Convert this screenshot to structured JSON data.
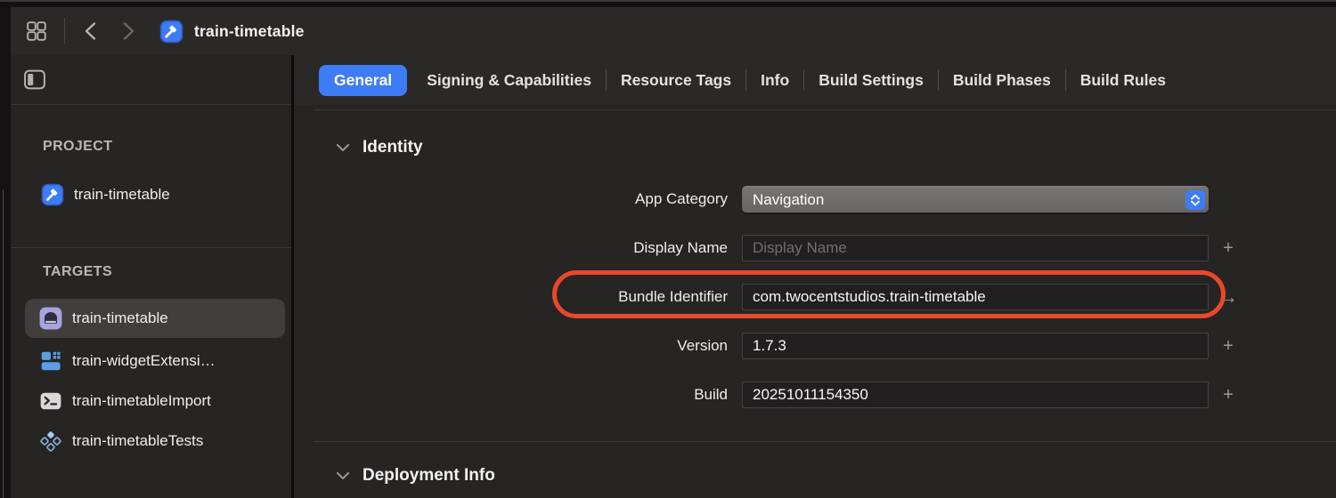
{
  "toolbar": {
    "title": "train-timetable",
    "icons": [
      "apps-grid-icon",
      "back-chevron-icon",
      "forward-chevron-icon",
      "xcode-project-icon"
    ]
  },
  "tabs": [
    {
      "label": "General",
      "selected": true
    },
    {
      "label": "Signing & Capabilities",
      "selected": false
    },
    {
      "label": "Resource Tags",
      "selected": false
    },
    {
      "label": "Info",
      "selected": false
    },
    {
      "label": "Build Settings",
      "selected": false
    },
    {
      "label": "Build Phases",
      "selected": false
    },
    {
      "label": "Build Rules",
      "selected": false
    }
  ],
  "sidebar": {
    "project_header": "PROJECT",
    "project_item": {
      "label": "train-timetable",
      "icon": "xcode-project-icon"
    },
    "targets_header": "TARGETS",
    "targets": [
      {
        "label": "train-timetable",
        "icon": "app-target-icon",
        "selected": true
      },
      {
        "label": "train-widgetExtensi…",
        "icon": "widget-extension-icon",
        "selected": false
      },
      {
        "label": "train-timetableImport",
        "icon": "terminal-icon",
        "selected": false
      },
      {
        "label": "train-timetableTests",
        "icon": "tests-icon",
        "selected": false
      }
    ]
  },
  "identity": {
    "title": "Identity",
    "rows": [
      {
        "label": "App Category",
        "control": "popup",
        "value": "Navigation",
        "trailing": ""
      },
      {
        "label": "Display Name",
        "control": "textfield",
        "value": "",
        "placeholder": "Display Name",
        "trailing": "+"
      },
      {
        "label": "Bundle Identifier",
        "control": "textfield",
        "value": "com.twocentstudios.train-timetable",
        "trailing": "→",
        "annotated": true
      },
      {
        "label": "Version",
        "control": "textfield",
        "value": "1.7.3",
        "trailing": "+"
      },
      {
        "label": "Build",
        "control": "textfield",
        "value": "20251011154350",
        "trailing": "+"
      }
    ]
  },
  "deployment": {
    "title": "Deployment Info"
  },
  "colors": {
    "accent": "#3e7bf6",
    "annotation": "#e8492b",
    "selection_bg": "#413e3e",
    "field_bg": "#211f1f",
    "field_border": "#454242",
    "popup_bg": "#6c6a69",
    "background": "#272424"
  }
}
